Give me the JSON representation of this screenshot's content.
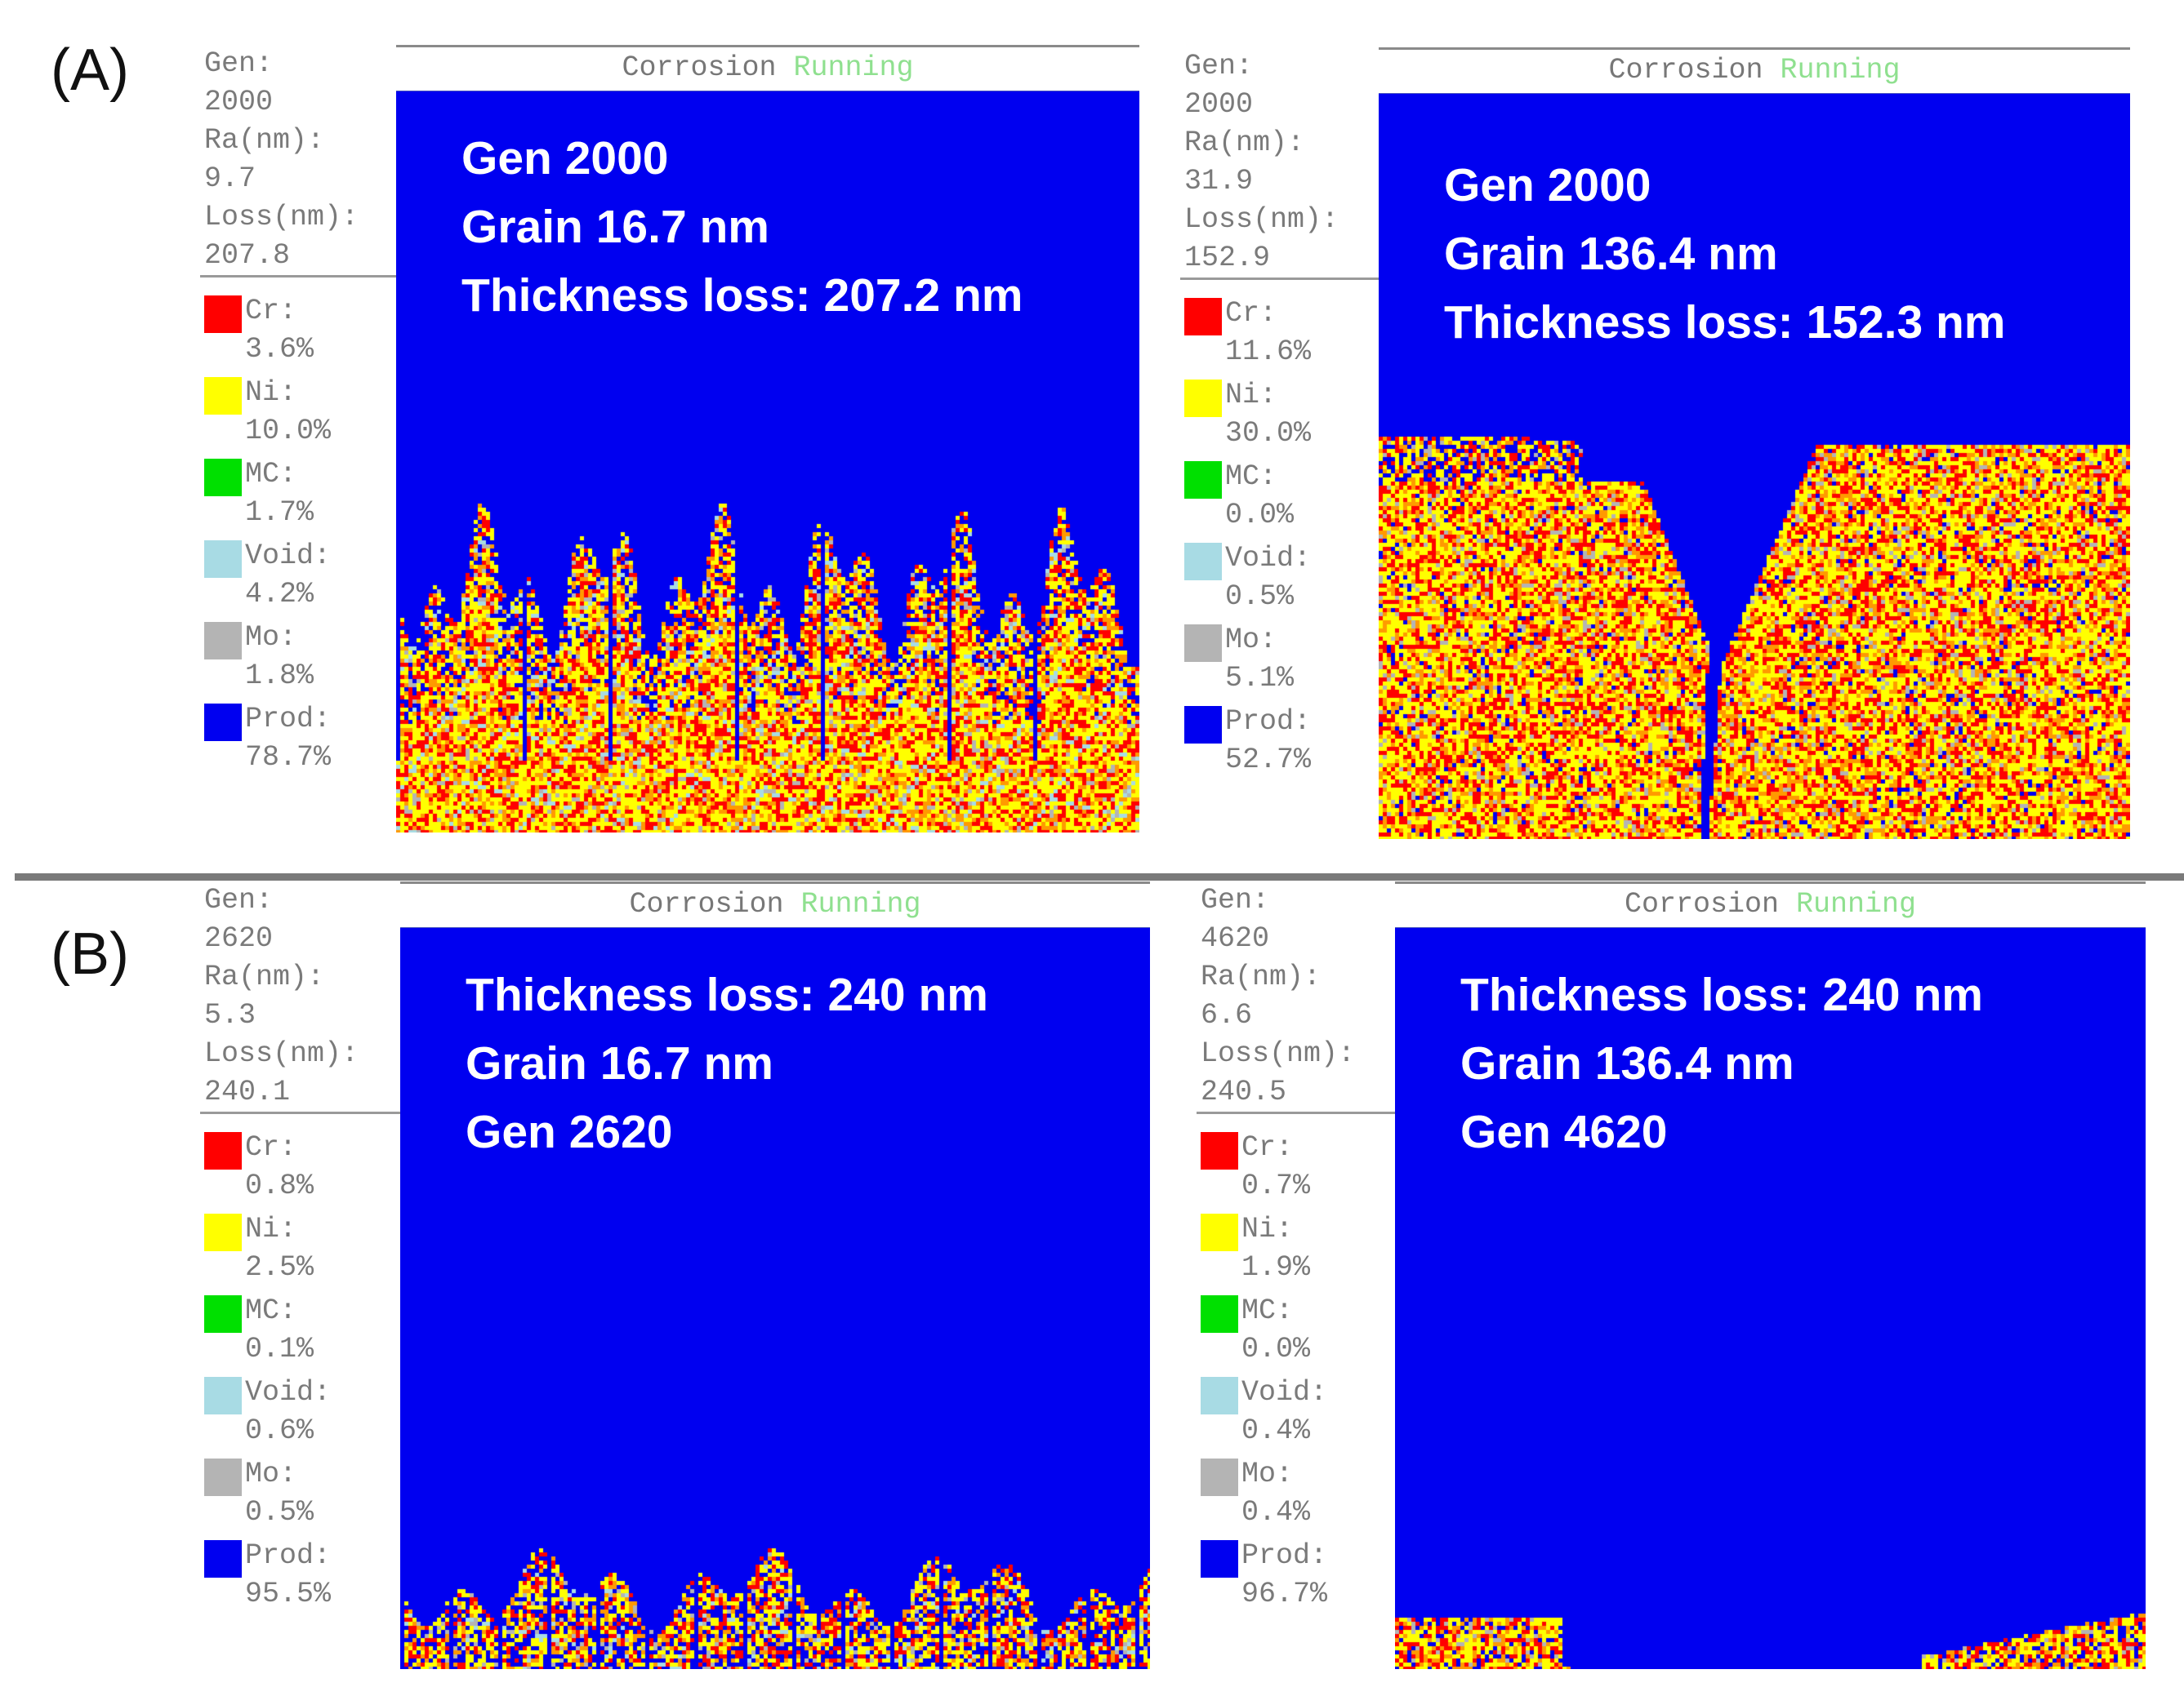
{
  "figure_labels": {
    "a": "(A)",
    "b": "(B)"
  },
  "colors": {
    "Cr": "#ff0000",
    "Ni": "#ffff00",
    "MC": "#00e000",
    "Void": "#a8dbe4",
    "Mo": "#b4b4b4",
    "Prod": "#0000f0"
  },
  "panels": [
    {
      "header": {
        "title": "Corrosion",
        "status": "Running"
      },
      "stats": [
        {
          "label": "Gen:",
          "value": "2000"
        },
        {
          "label": "Ra(nm):",
          "value": "9.7"
        },
        {
          "label": "Loss(nm):",
          "value": "207.8"
        }
      ],
      "legend": [
        {
          "name": "Cr:",
          "value": "3.6%"
        },
        {
          "name": "Ni:",
          "value": "10.0%"
        },
        {
          "name": "MC:",
          "value": "1.7%"
        },
        {
          "name": "Void:",
          "value": "4.2%"
        },
        {
          "name": "Mo:",
          "value": "1.8%"
        },
        {
          "name": "Prod:",
          "value": "78.7%"
        }
      ],
      "overlay": [
        "Gen 2000",
        "Grain 16.7 nm",
        "Thickness loss: 207.2 nm"
      ]
    },
    {
      "header": {
        "title": "Corrosion",
        "status": "Running"
      },
      "stats": [
        {
          "label": "Gen:",
          "value": "2000"
        },
        {
          "label": "Ra(nm):",
          "value": "31.9"
        },
        {
          "label": "Loss(nm):",
          "value": "152.9"
        }
      ],
      "legend": [
        {
          "name": "Cr:",
          "value": "11.6%"
        },
        {
          "name": "Ni:",
          "value": "30.0%"
        },
        {
          "name": "MC:",
          "value": "0.0%"
        },
        {
          "name": "Void:",
          "value": "0.5%"
        },
        {
          "name": "Mo:",
          "value": "5.1%"
        },
        {
          "name": "Prod:",
          "value": "52.7%"
        }
      ],
      "overlay": [
        "Gen 2000",
        "Grain 136.4 nm",
        "Thickness loss: 152.3 nm"
      ]
    },
    {
      "header": {
        "title": "Corrosion",
        "status": "Running"
      },
      "stats": [
        {
          "label": "Gen:",
          "value": "2620"
        },
        {
          "label": "Ra(nm):",
          "value": "5.3"
        },
        {
          "label": "Loss(nm):",
          "value": "240.1"
        }
      ],
      "legend": [
        {
          "name": "Cr:",
          "value": "0.8%"
        },
        {
          "name": "Ni:",
          "value": "2.5%"
        },
        {
          "name": "MC:",
          "value": "0.1%"
        },
        {
          "name": "Void:",
          "value": "0.6%"
        },
        {
          "name": "Mo:",
          "value": "0.5%"
        },
        {
          "name": "Prod:",
          "value": "95.5%"
        }
      ],
      "overlay": [
        "Thickness loss: 240 nm",
        "Grain 16.7 nm",
        "Gen 2620"
      ]
    },
    {
      "header": {
        "title": "Corrosion",
        "status": "Running"
      },
      "stats": [
        {
          "label": "Gen:",
          "value": "4620"
        },
        {
          "label": "Ra(nm):",
          "value": "6.6"
        },
        {
          "label": "Loss(nm):",
          "value": "240.5"
        }
      ],
      "legend": [
        {
          "name": "Cr:",
          "value": "0.7%"
        },
        {
          "name": "Ni:",
          "value": "1.9%"
        },
        {
          "name": "MC:",
          "value": "0.0%"
        },
        {
          "name": "Void:",
          "value": "0.4%"
        },
        {
          "name": "Mo:",
          "value": "0.4%"
        },
        {
          "name": "Prod:",
          "value": "96.7%"
        }
      ],
      "overlay": [
        "Thickness loss: 240 nm",
        "Grain 136.4 nm",
        "Gen 4620"
      ]
    }
  ]
}
